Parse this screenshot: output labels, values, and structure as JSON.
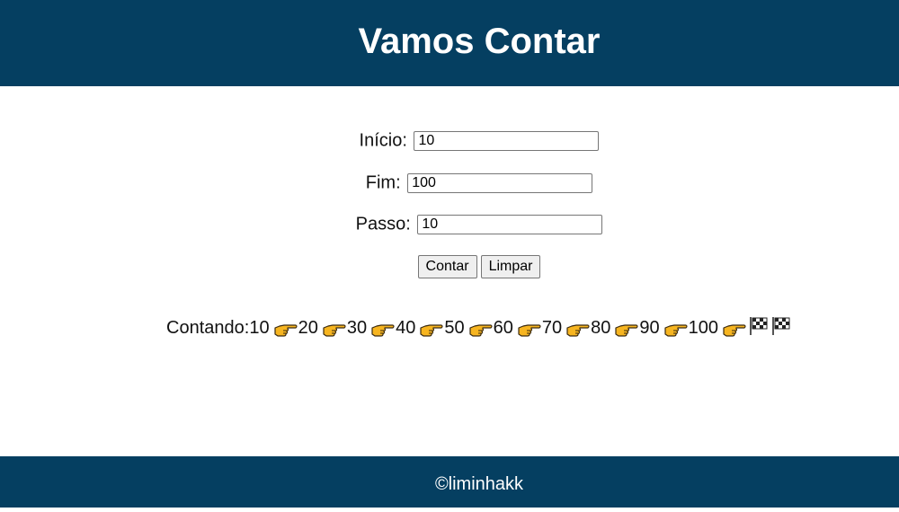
{
  "header": {
    "title": "Vamos Contar"
  },
  "form": {
    "inicio": {
      "label": "Início:",
      "value": "10"
    },
    "fim": {
      "label": "Fim:",
      "value": "100"
    },
    "passo": {
      "label": "Passo:",
      "value": "10"
    },
    "contar_label": "Contar",
    "limpar_label": "Limpar"
  },
  "result": {
    "prefix": "Contando:",
    "numbers": [
      "10",
      "20",
      "30",
      "40",
      "50",
      "60",
      "70",
      "80",
      "90",
      "100"
    ],
    "separator_icon": "pointing-hand-icon",
    "end_icon": "checkered-flag-icon"
  },
  "footer": {
    "text": "©liminhakk"
  },
  "colors": {
    "header_bg": "#053f61",
    "footer_bg": "#053f61",
    "hand": "#f7b520"
  }
}
